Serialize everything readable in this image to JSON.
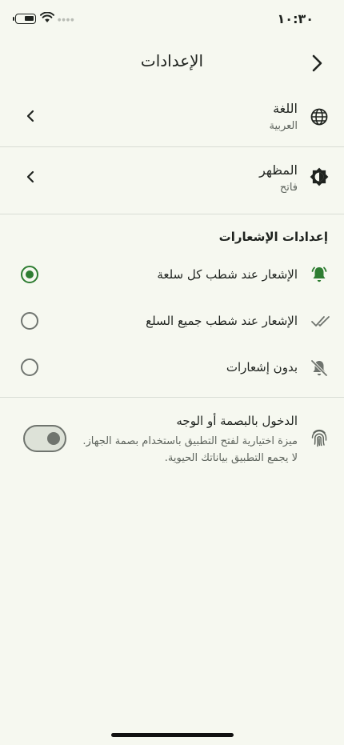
{
  "status_bar": {
    "time": "١٠:٣٠"
  },
  "header": {
    "title": "الإعدادات"
  },
  "language": {
    "title": "اللغة",
    "value": "العربية"
  },
  "appearance": {
    "title": "المظهر",
    "value": "فاتح"
  },
  "notifications": {
    "section_title": "إعدادات الإشعارات",
    "options": [
      {
        "label": "الإشعار عند شطب كل سلعة",
        "selected": true
      },
      {
        "label": "الإشعار عند شطب جميع السلع",
        "selected": false
      },
      {
        "label": "بدون إشعارات",
        "selected": false
      }
    ]
  },
  "biometric": {
    "title": "الدخول بالبصمة أو الوجه",
    "desc_line1": "ميزة اختيارية لفتح التطبيق باستخدام بصمة الجهاز.",
    "desc_line2": "لا يجمع التطبيق بياناتك الحيوية.",
    "enabled": false
  },
  "colors": {
    "accent": "#2e7d32",
    "background": "#f6f8f0",
    "divider": "#d9ddd5"
  }
}
